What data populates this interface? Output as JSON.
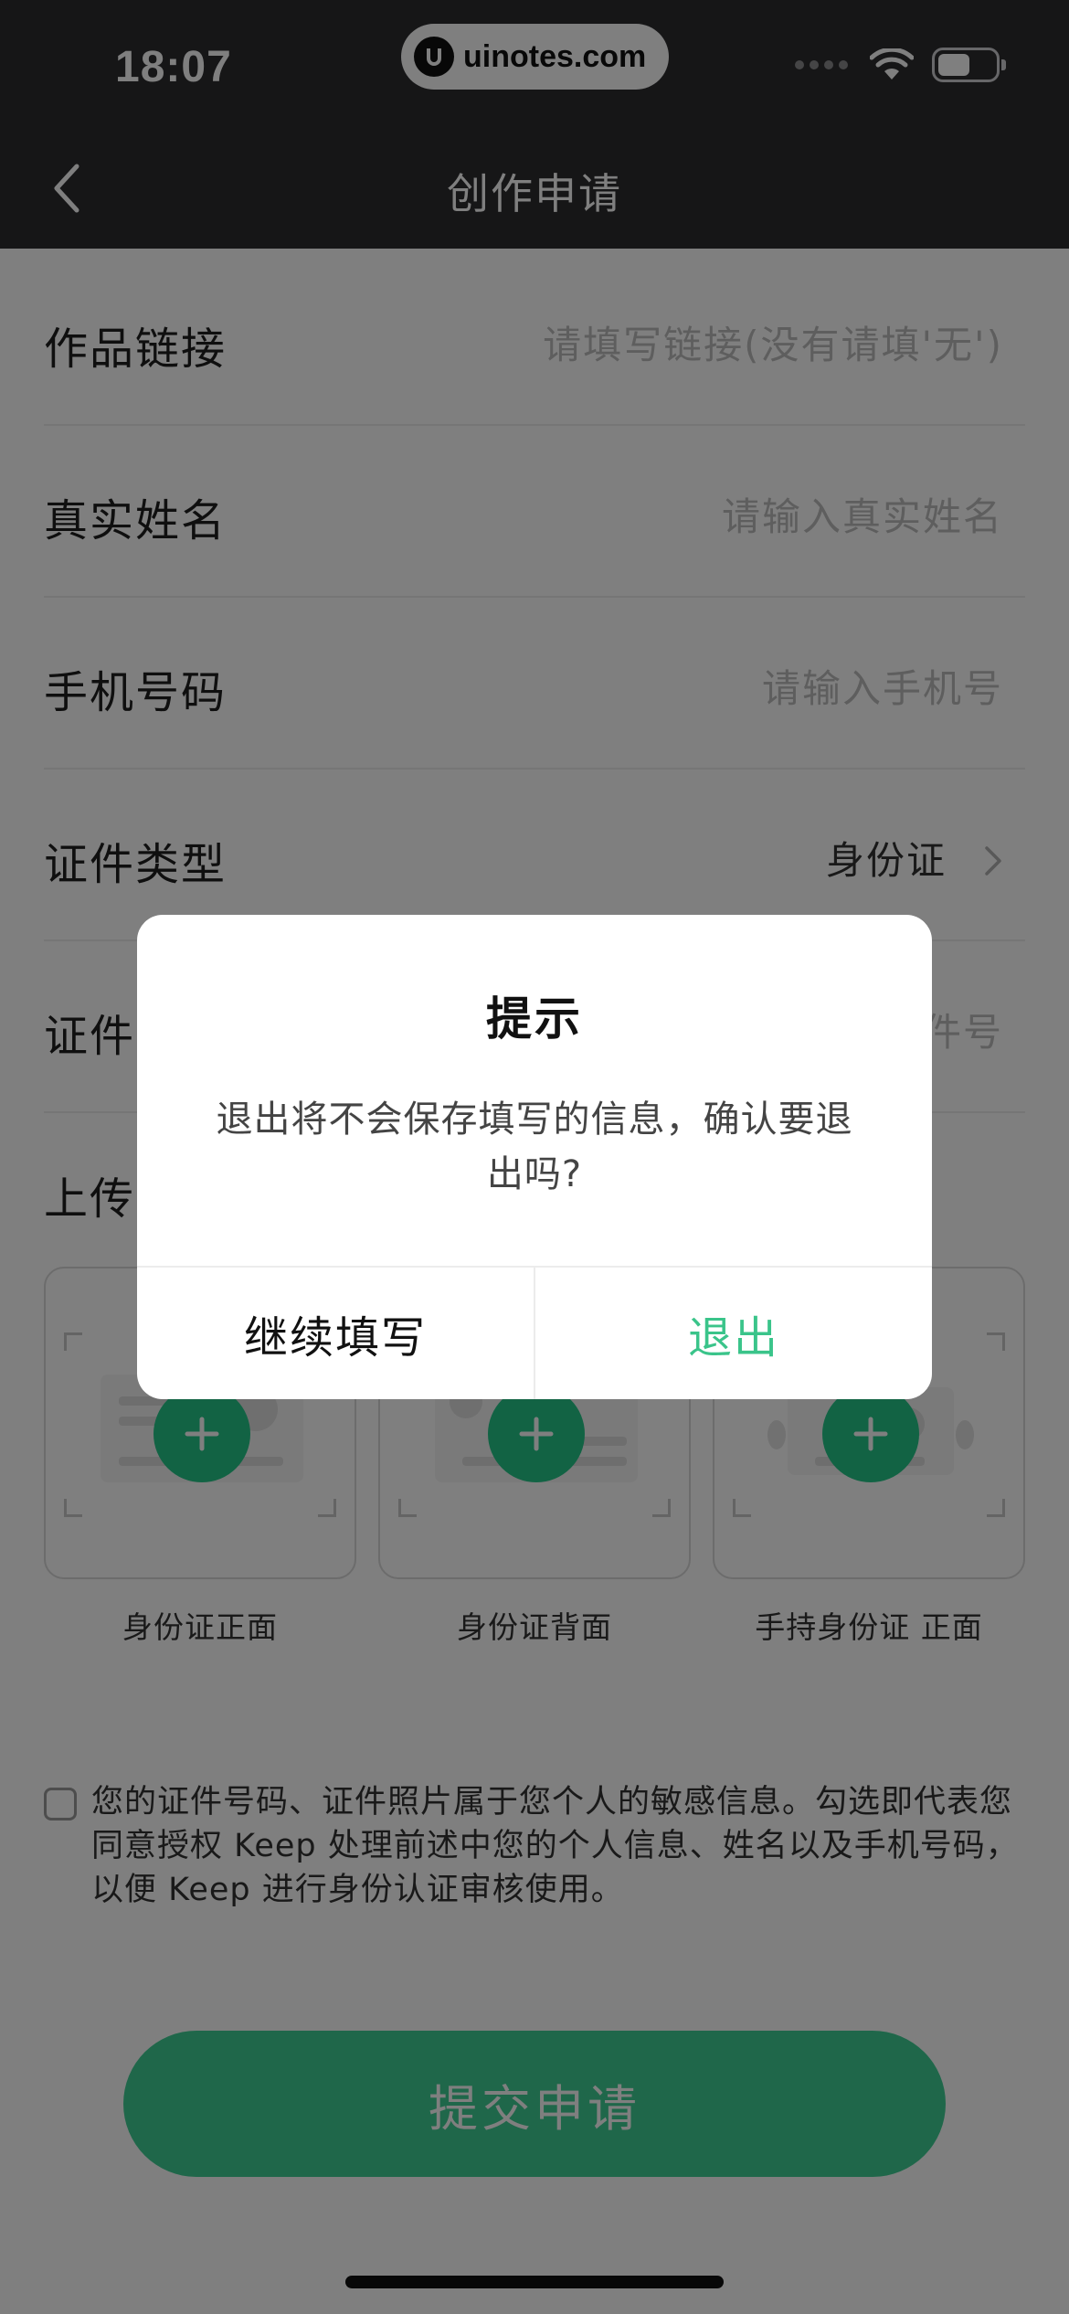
{
  "status_bar": {
    "time": "18:07",
    "url": "uinotes.com"
  },
  "nav": {
    "title": "创作申请",
    "back_icon": "chevron-left-icon"
  },
  "form": {
    "rows": [
      {
        "label": "作品链接",
        "value": "请填写链接(没有请填'无')",
        "is_placeholder": true
      },
      {
        "label": "真实姓名",
        "value": "请输入真实姓名",
        "is_placeholder": true
      },
      {
        "label": "手机号码",
        "value": "请输入手机号",
        "is_placeholder": true
      },
      {
        "label": "证件类型",
        "value": "身份证",
        "is_placeholder": false
      },
      {
        "label": "证件号码",
        "value": "请输入证件号",
        "is_placeholder": true
      }
    ],
    "upload_label": "上传证件照片",
    "upload_cards": [
      {
        "caption": "身份证正面"
      },
      {
        "caption": "身份证背面"
      },
      {
        "caption": "手持身份证 正面"
      }
    ],
    "consent_text": "您的证件号码、证件照片属于您个人的敏感信息。勾选即代表您同意授权 Keep 处理前述中您的个人信息、姓名以及手机号码，以便 Keep 进行身份认证审核使用。",
    "consent_checked": false,
    "submit_label": "提交申请"
  },
  "dialog": {
    "title": "提示",
    "message": "退出将不会保存填写的信息，确认要退出吗?",
    "cancel_label": "继续填写",
    "confirm_label": "退出"
  },
  "colors": {
    "accent": "#24c789",
    "nav_bg": "#2c2c2f",
    "confirm_text": "#3ac48a"
  }
}
